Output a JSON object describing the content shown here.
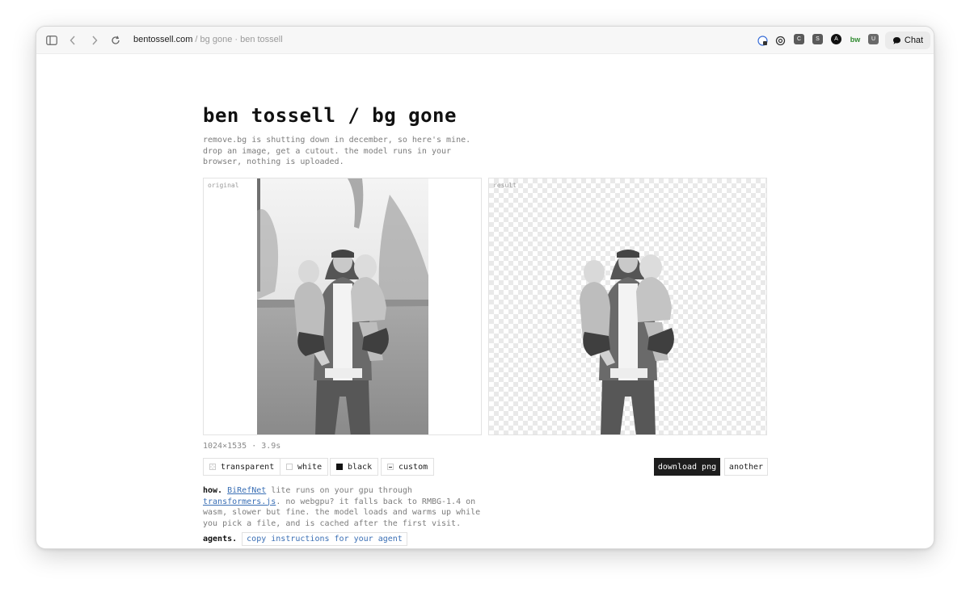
{
  "browser": {
    "address_host": "bentossell.com",
    "address_rest": " / bg gone · ben tossell",
    "chat_label": "Chat",
    "extensions": [
      {
        "icon": "extension-c-icon",
        "label": "C",
        "color": "#5a5a5a"
      },
      {
        "icon": "extension-s-icon",
        "label": "S",
        "color": "#5a5a5a"
      },
      {
        "icon": "extension-a-icon",
        "label": "A",
        "color": "#111111"
      },
      {
        "icon": "extension-bw-icon",
        "label": "bw",
        "color": "#2f8a2f"
      },
      {
        "icon": "extension-u-icon",
        "label": "U",
        "color": "#6a6a6a"
      }
    ]
  },
  "page": {
    "title": "ben tossell / bg gone",
    "description": "remove.bg is shutting down in december, so here's mine. drop an image, get a cutout. the model runs in your browser, nothing is uploaded.",
    "original_label": "original",
    "result_label": "result",
    "meta": "1024×1535 · 3.9s",
    "backgrounds": [
      {
        "label": "transparent",
        "swatch": "#f2f2f2"
      },
      {
        "label": "white",
        "swatch": "#ffffff"
      },
      {
        "label": "black",
        "swatch": "#111111"
      },
      {
        "label": "custom",
        "swatch": "#ffffff"
      }
    ],
    "download_label": "download png",
    "another_label": "another",
    "how": {
      "prefix": "how.",
      "link1": "BiRefNet",
      "text1": " lite runs on your gpu through ",
      "link2": "transformers.js",
      "text2": ". no webgpu? it falls back to RMBG-1.4 on wasm, slower but fine. the model loads and warms up while you pick a file, and is cached after the first visit."
    },
    "agents": {
      "label": "agents.",
      "button": "copy instructions for your agent"
    }
  }
}
